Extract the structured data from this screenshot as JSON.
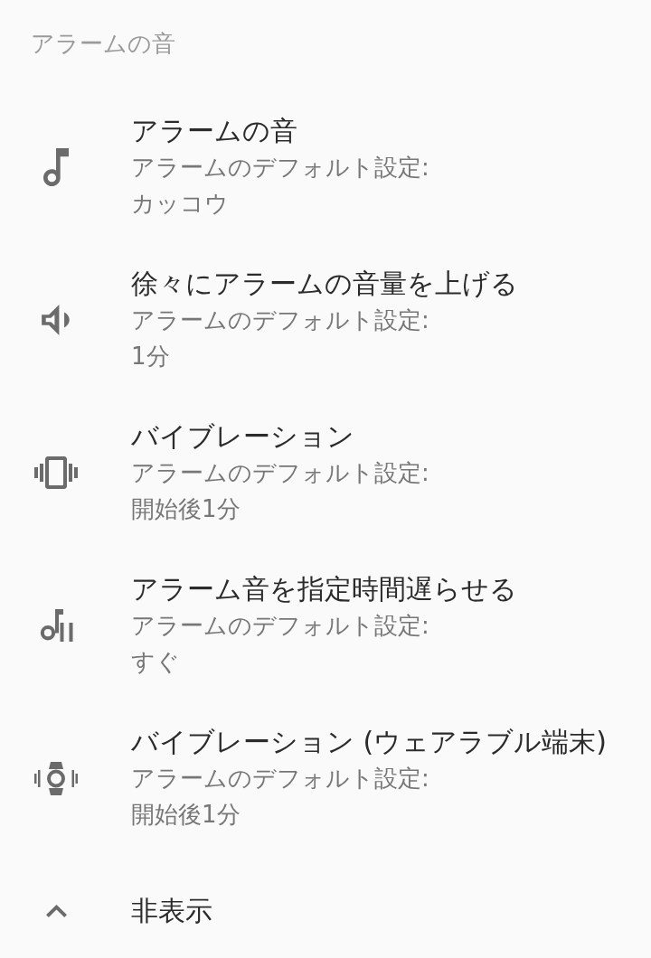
{
  "section_header": {
    "title": "アラームの音"
  },
  "settings": [
    {
      "kind": "note",
      "title": "アラームの音",
      "summary": "アラームのデフォルト設定:",
      "value": "カッコウ"
    },
    {
      "kind": "volume",
      "title": "徐々にアラームの音量を上げる",
      "summary": "アラームのデフォルト設定:",
      "value": "1分"
    },
    {
      "kind": "vibrate",
      "title": "バイブレーション",
      "summary": "アラームのデフォルト設定:",
      "value": "開始後1分"
    },
    {
      "kind": "delay",
      "title": "アラーム音を指定時間遅らせる",
      "summary": "アラームのデフォルト設定:",
      "value": "すぐ"
    },
    {
      "kind": "watch",
      "title": "バイブレーション (ウェアラブル端末)",
      "summary": "アラームのデフォルト設定:",
      "value": "開始後1分"
    }
  ],
  "collapse_toggle": {
    "label": "非表示",
    "expanded": true
  }
}
